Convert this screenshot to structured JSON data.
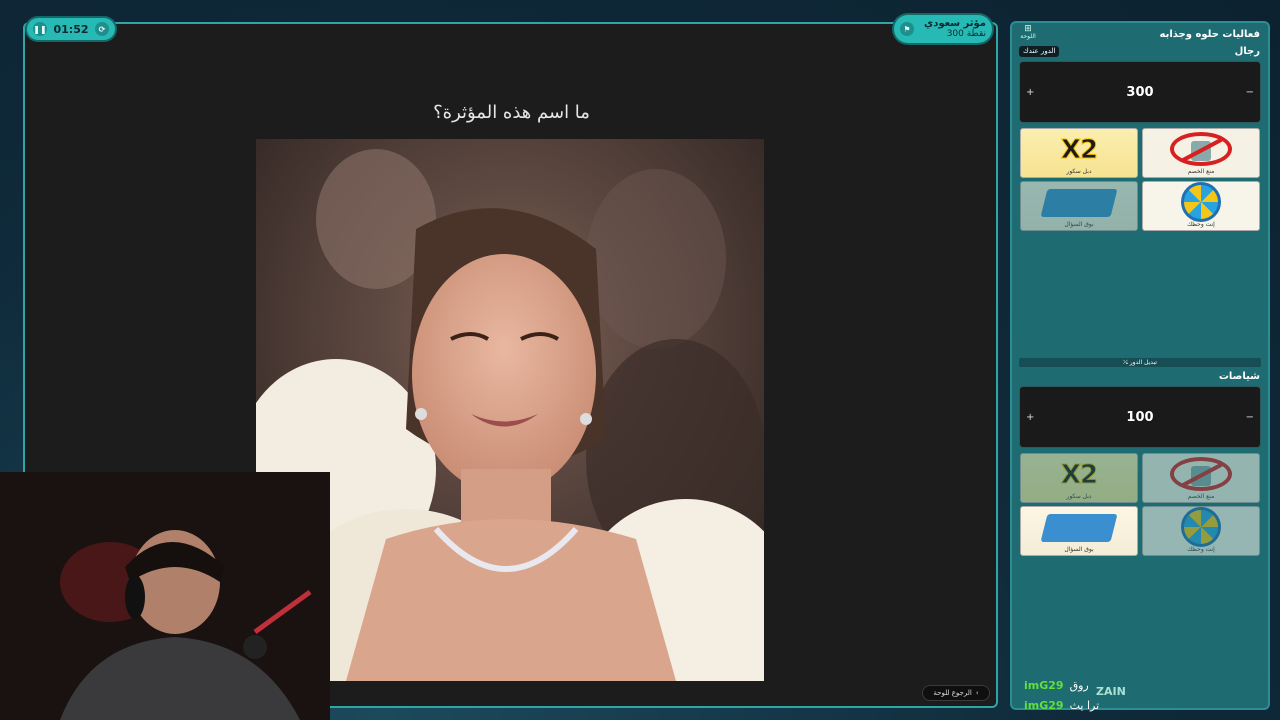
{
  "timer": {
    "time": "01:52",
    "pause_icon": "pause-icon",
    "reset_icon": "timer-icon"
  },
  "current_team": {
    "name": "مؤثر سعودي",
    "points": "300 نقطة"
  },
  "question": "ما اسم هذه المؤثرة؟",
  "back_button": {
    "label": "الرجوع للوحة"
  },
  "sidebar": {
    "home_label": "اللوحة",
    "title": "فعاليات حلوه وجذابه",
    "turn_badge": "الدور عندك",
    "swap_label": "⤯ تبديل الدور",
    "teams": [
      {
        "name": "رجال",
        "score": "300",
        "minus": "−",
        "plus": "+",
        "cards": [
          {
            "title": "X2",
            "label": "دبل سكور",
            "type": "x2",
            "dim": false
          },
          {
            "title": "",
            "label": "منع الخصم",
            "type": "block",
            "dim": false
          },
          {
            "title": "",
            "label": "بوق السؤال",
            "type": "cards",
            "dim": true
          },
          {
            "title": "",
            "label": "إنت وحظك",
            "type": "wheel",
            "dim": false
          }
        ]
      },
      {
        "name": "شياصات",
        "score": "100",
        "minus": "−",
        "plus": "+",
        "cards": [
          {
            "title": "X2",
            "label": "دبل سكور",
            "type": "x2",
            "dim": true
          },
          {
            "title": "",
            "label": "منع الخصم",
            "type": "block",
            "dim": true
          },
          {
            "title": "",
            "label": "بوق السؤال",
            "type": "cards",
            "dim": false
          },
          {
            "title": "",
            "label": "إنت وحظك",
            "type": "wheel",
            "dim": true
          }
        ]
      }
    ]
  },
  "chat": [
    {
      "user": "imG29",
      "message": "روق"
    },
    {
      "user": "imG29",
      "message": "ترا يث"
    }
  ],
  "brand_label": "ZAIN",
  "colors": {
    "accent": "#27b9b4",
    "sidebar": "#1e6b72",
    "panel": "#1c1c1c",
    "chat_user": "#5fe03a"
  }
}
